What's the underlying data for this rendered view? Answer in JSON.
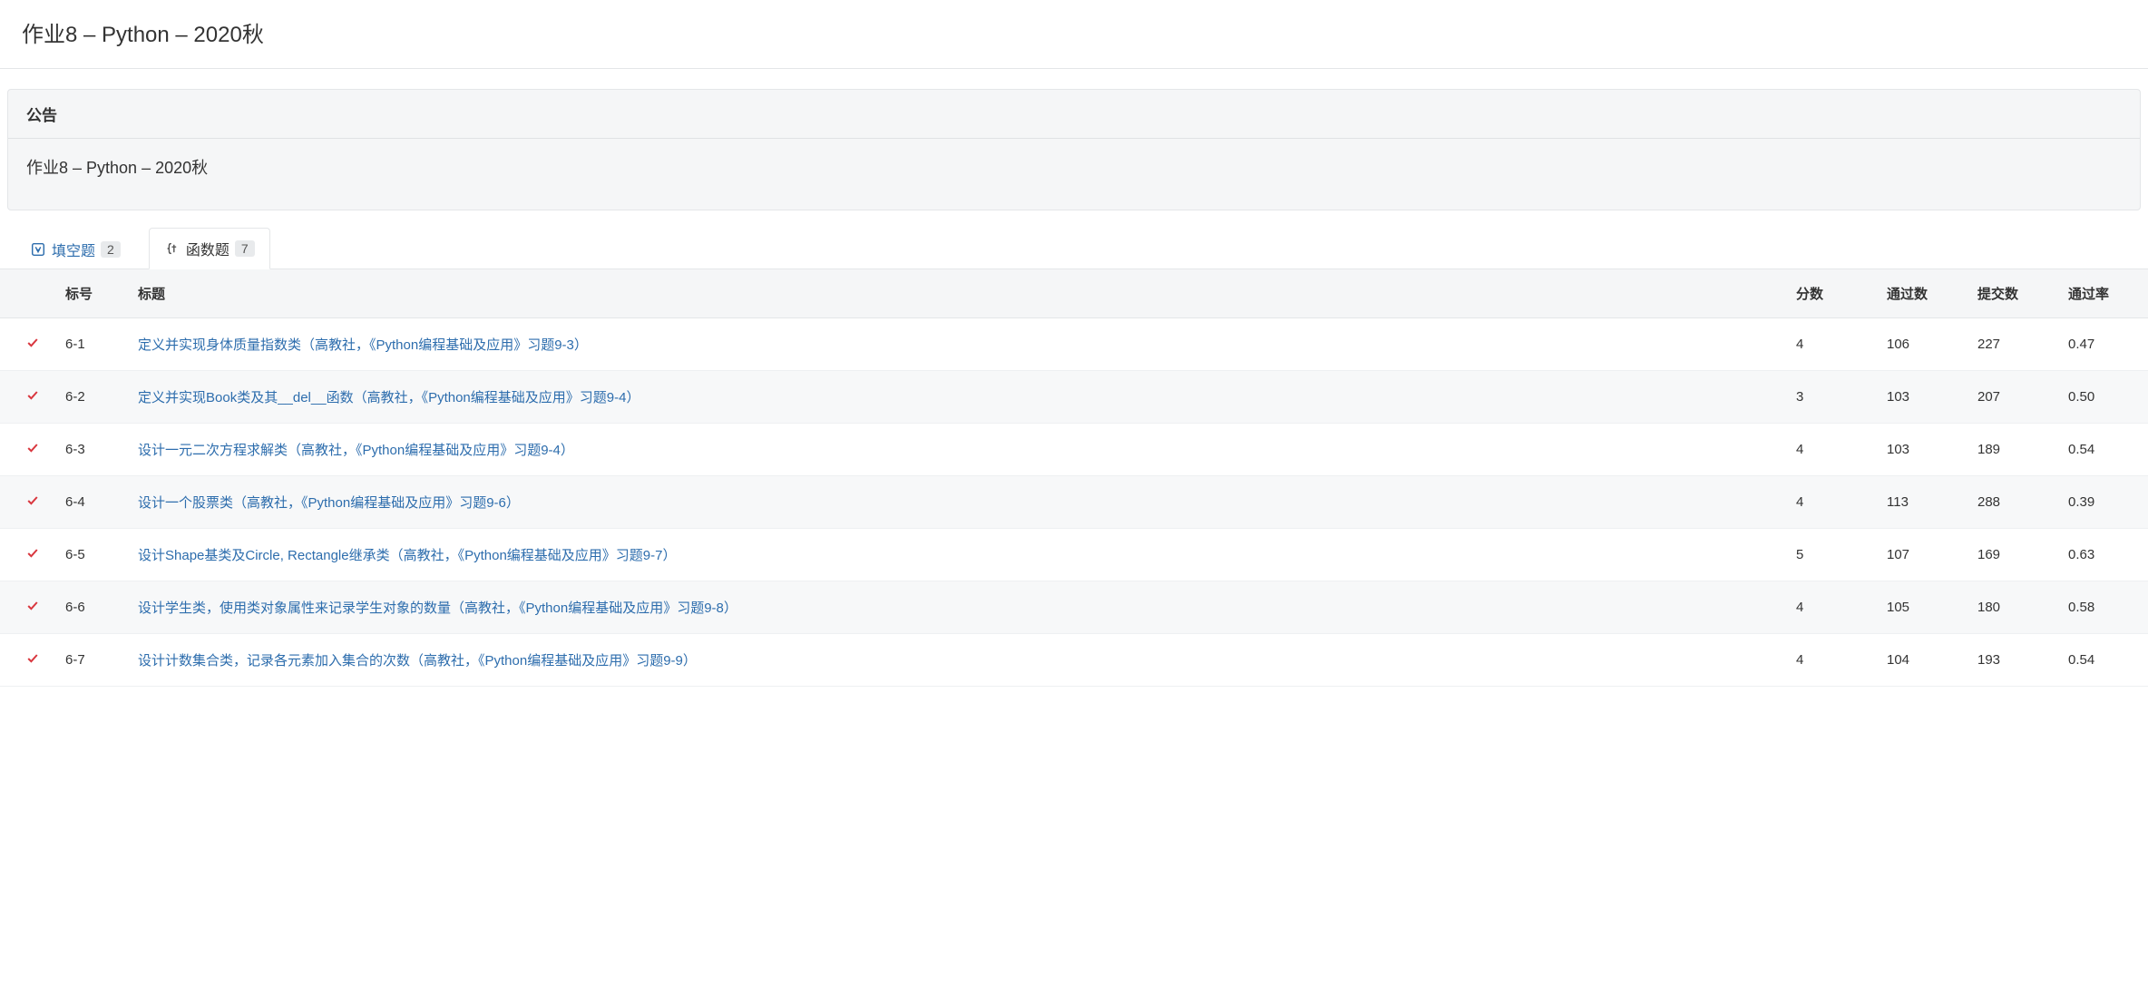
{
  "page_title": "作业8 – Python – 2020秋",
  "announcement": {
    "header": "公告",
    "body": "作业8 – Python – 2020秋"
  },
  "tabs": [
    {
      "label": "填空题",
      "count": "2",
      "active": false
    },
    {
      "label": "函数题",
      "count": "7",
      "active": true
    }
  ],
  "table": {
    "headers": {
      "status": "",
      "id": "标号",
      "title": "标题",
      "score": "分数",
      "pass_count": "通过数",
      "submit_count": "提交数",
      "pass_rate": "通过率"
    },
    "rows": [
      {
        "status": "done",
        "id": "6-1",
        "title": "定义并实现身体质量指数类（高教社，《Python编程基础及应用》习题9-3）",
        "score": "4",
        "pass_count": "106",
        "submit_count": "227",
        "pass_rate": "0.47"
      },
      {
        "status": "done",
        "id": "6-2",
        "title": "定义并实现Book类及其__del__函数（高教社，《Python编程基础及应用》习题9-4）",
        "score": "3",
        "pass_count": "103",
        "submit_count": "207",
        "pass_rate": "0.50"
      },
      {
        "status": "done",
        "id": "6-3",
        "title": "设计一元二次方程求解类（高教社，《Python编程基础及应用》习题9-4）",
        "score": "4",
        "pass_count": "103",
        "submit_count": "189",
        "pass_rate": "0.54"
      },
      {
        "status": "done",
        "id": "6-4",
        "title": "设计一个股票类（高教社，《Python编程基础及应用》习题9-6）",
        "score": "4",
        "pass_count": "113",
        "submit_count": "288",
        "pass_rate": "0.39"
      },
      {
        "status": "done",
        "id": "6-5",
        "title": "设计Shape基类及Circle, Rectangle继承类（高教社，《Python编程基础及应用》习题9-7）",
        "score": "5",
        "pass_count": "107",
        "submit_count": "169",
        "pass_rate": "0.63"
      },
      {
        "status": "done",
        "id": "6-6",
        "title": "设计学生类，使用类对象属性来记录学生对象的数量（高教社，《Python编程基础及应用》习题9-8）",
        "score": "4",
        "pass_count": "105",
        "submit_count": "180",
        "pass_rate": "0.58"
      },
      {
        "status": "done",
        "id": "6-7",
        "title": "设计计数集合类，记录各元素加入集合的次数（高教社，《Python编程基础及应用》习题9-9）",
        "score": "4",
        "pass_count": "104",
        "submit_count": "193",
        "pass_rate": "0.54"
      }
    ]
  }
}
